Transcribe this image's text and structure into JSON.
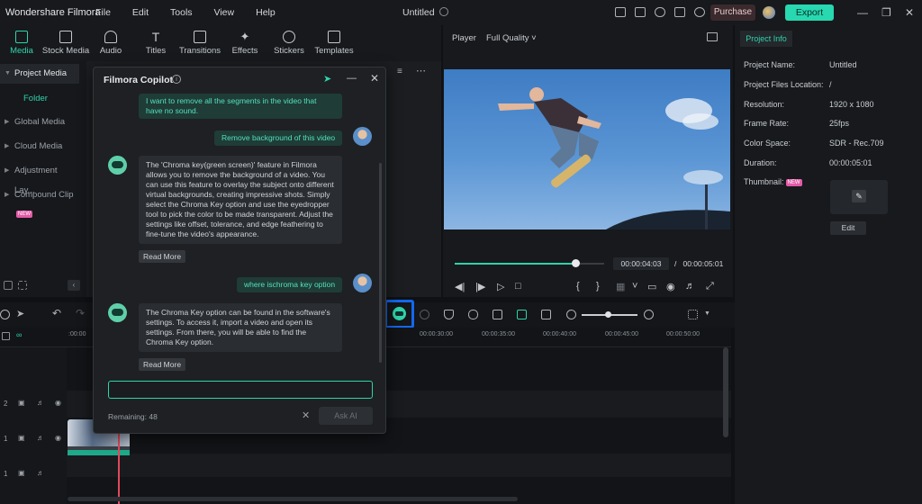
{
  "app": {
    "name": "Wondershare Filmora",
    "menu": [
      "File",
      "Edit",
      "Tools",
      "View",
      "Help"
    ],
    "document_title": "Untitled",
    "purchase_label": "Purchase",
    "export_label": "Export"
  },
  "toolbar": {
    "tabs": [
      {
        "label": "Media",
        "icon": "media-icon",
        "active": true
      },
      {
        "label": "Stock Media",
        "icon": "stock-media-icon"
      },
      {
        "label": "Audio",
        "icon": "music-note-icon"
      },
      {
        "label": "Titles",
        "icon": "text-t-icon"
      },
      {
        "label": "Transitions",
        "icon": "transitions-icon"
      },
      {
        "label": "Effects",
        "icon": "sparkle-icon"
      },
      {
        "label": "Stickers",
        "icon": "stickers-icon"
      },
      {
        "label": "Templates",
        "icon": "templates-icon"
      }
    ]
  },
  "sidebar": {
    "items": [
      {
        "label": "Project Media",
        "selected": true
      },
      {
        "label": "Folder"
      },
      {
        "label": "Global Media"
      },
      {
        "label": "Cloud Media"
      },
      {
        "label": "Adjustment Lay..."
      },
      {
        "label": "Compound Clip",
        "badge": "NEW"
      }
    ]
  },
  "player": {
    "label": "Player",
    "quality": "Full Quality",
    "current_time": "00:00:04:03",
    "separator": "/",
    "total_time": "00:00:05:01",
    "progress": 0.81
  },
  "info": {
    "tab": "Project Info",
    "rows": [
      {
        "key": "Project Name:",
        "value": "Untitled"
      },
      {
        "key": "Project Files Location:",
        "value": "/"
      },
      {
        "key": "Resolution:",
        "value": "1920 x 1080"
      },
      {
        "key": "Frame Rate:",
        "value": "25fps"
      },
      {
        "key": "Color Space:",
        "value": "SDR - Rec.709"
      },
      {
        "key": "Duration:",
        "value": "00:00:05:01"
      },
      {
        "key": "Thumbnail:",
        "value": ""
      }
    ],
    "thumbnail_badge": "NEW",
    "edit_label": "Edit"
  },
  "timeline": {
    "ruler": [
      ":00:00",
      "00:00:30:00",
      "00:00:35:00",
      "00:00:40:00",
      "00:00:45:00",
      "00:00:50:00"
    ],
    "track_labels": [
      "2",
      "1",
      "1"
    ]
  },
  "copilot": {
    "title": "Filmora Copilot",
    "messages": [
      {
        "from": "user",
        "text": "I want to remove all the segments in the video that have no sound."
      },
      {
        "from": "user",
        "text": "Remove background of this video"
      },
      {
        "from": "ai",
        "text": "The 'Chroma key(green screen)' feature in Filmora allows you to remove the background of a video. You can use this feature to overlay the subject onto different virtual backgrounds, creating impressive shots. Simply select the Chroma Key option and use the eyedropper tool to pick the color to be made transparent. Adjust the settings like offset, tolerance, and edge feathering to fine-tune the video's appearance."
      },
      {
        "from": "user",
        "text": "where ischroma key option"
      },
      {
        "from": "ai",
        "text": "The Chroma Key option can be found in the software's settings. To access it, import a video and open its settings. From there, you will be able to find the Chroma Key option."
      }
    ],
    "read_more_label": "Read More",
    "input_value": "",
    "remaining": "Remaining: 48",
    "ask_label": "Ask AI"
  }
}
